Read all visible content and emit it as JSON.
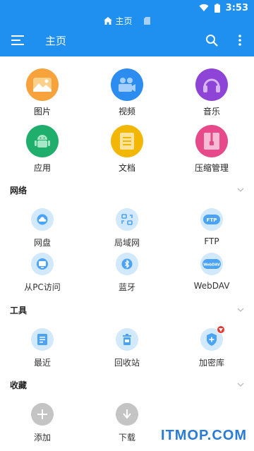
{
  "status_bar": {
    "time": "3:53"
  },
  "breadcrumb": {
    "current": "主页"
  },
  "toolbar": {
    "title": "主页"
  },
  "library": [
    {
      "label": "图片",
      "icon": "image-icon",
      "color": "#f7a23b"
    },
    {
      "label": "视频",
      "icon": "video-icon",
      "color": "#2d8cf0"
    },
    {
      "label": "音乐",
      "icon": "music-icon",
      "color": "#8e44d6"
    },
    {
      "label": "应用",
      "icon": "android-icon",
      "color": "#1fae6b"
    },
    {
      "label": "文档",
      "icon": "document-icon",
      "color": "#f2b705"
    },
    {
      "label": "压缩管理",
      "icon": "archive-icon",
      "color": "#e64a8a"
    }
  ],
  "network": {
    "title": "网络",
    "items": [
      {
        "label": "网盘",
        "icon": "cloud-icon"
      },
      {
        "label": "局域网",
        "icon": "lan-icon"
      },
      {
        "label": "FTP",
        "icon": "ftp-icon",
        "icon_text": "FTP"
      },
      {
        "label": "从PC访问",
        "icon": "monitor-icon"
      },
      {
        "label": "蓝牙",
        "icon": "bluetooth-icon"
      },
      {
        "label": "WebDAV",
        "icon": "webdav-icon",
        "icon_text": "WebDAV"
      }
    ]
  },
  "tools": {
    "title": "工具",
    "items": [
      {
        "label": "最近",
        "icon": "recent-icon"
      },
      {
        "label": "回收站",
        "icon": "recycle-bin-icon"
      },
      {
        "label": "加密库",
        "icon": "vault-icon"
      }
    ]
  },
  "favorites": {
    "title": "收藏",
    "items": [
      {
        "label": "添加",
        "icon": "add-icon"
      },
      {
        "label": "下载",
        "icon": "download-icon"
      }
    ]
  },
  "watermark": "ITMOP.COM",
  "colors": {
    "accent": "#1f8ff0",
    "icon_bg": "#d2e8fb",
    "icon_fg": "#2d8cf0"
  }
}
